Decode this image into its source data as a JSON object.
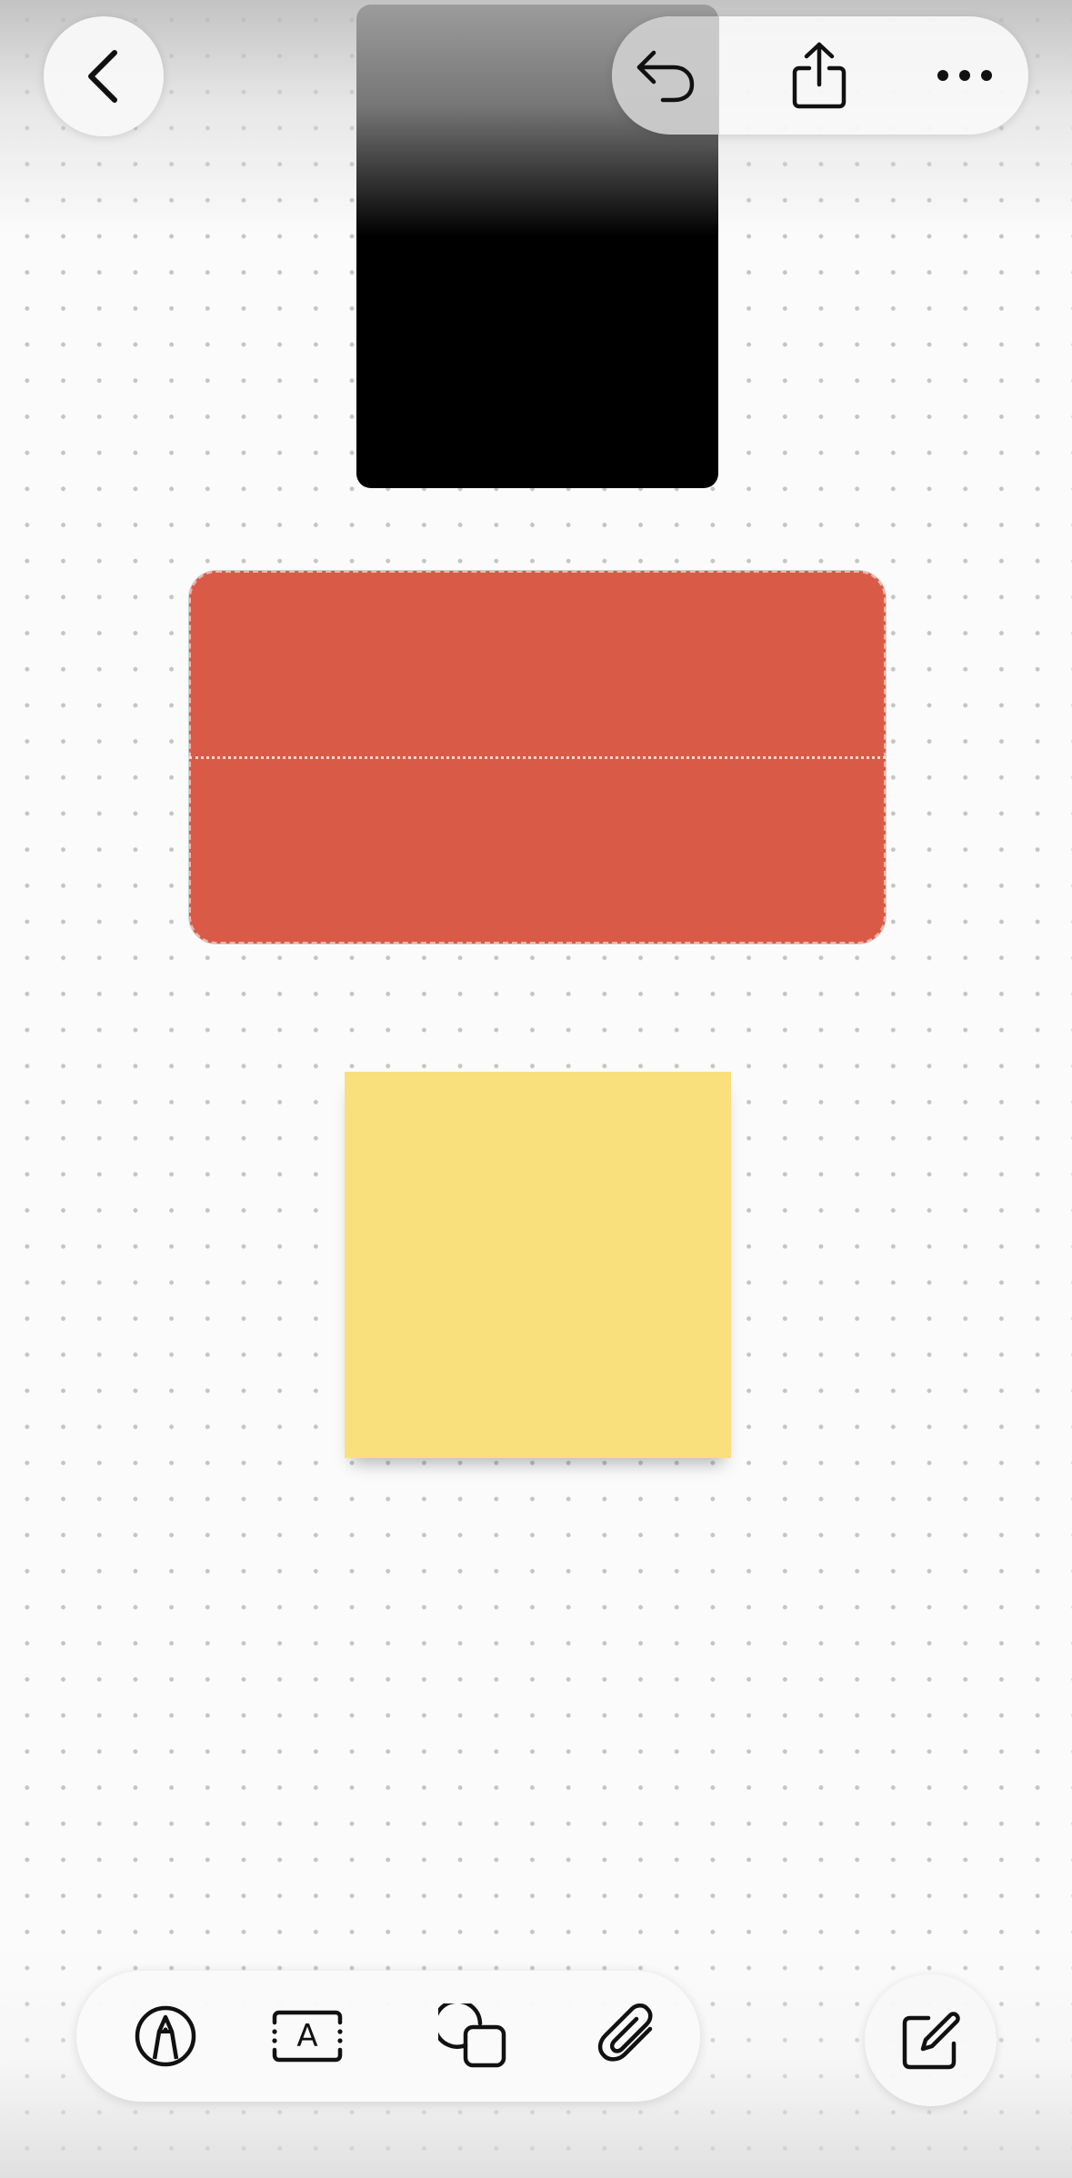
{
  "canvas": {
    "background": "#fbfbfb",
    "dot_color": "#c4c4c4",
    "items": [
      {
        "kind": "image",
        "color": "#000000"
      },
      {
        "kind": "shape",
        "color": "#d95b47"
      },
      {
        "kind": "sticky-note",
        "color": "#f9e07c"
      }
    ]
  },
  "top_bar": {
    "back_icon": "chevron-left-icon",
    "undo_icon": "undo-arrow-icon",
    "share_icon": "share-icon",
    "more_icon": "ellipsis-icon"
  },
  "tool_bar": {
    "text_tool_glyph": "A",
    "tools": [
      "pen-tip-icon",
      "text-box-icon",
      "shapes-icon",
      "paperclip-icon"
    ]
  },
  "compose_icon": "compose-icon"
}
